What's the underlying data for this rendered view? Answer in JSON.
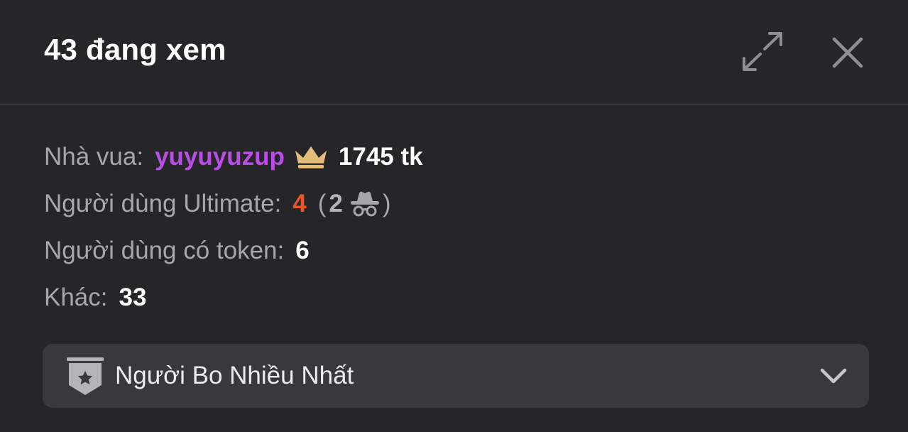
{
  "header": {
    "title": "43 đang xem",
    "expand_icon": "expand-arrows-icon",
    "close_icon": "close-icon"
  },
  "stats": {
    "king": {
      "label": "Nhà vua:",
      "name": "yuyuyuzup",
      "icon": "crown-icon",
      "amount": "1745 tk"
    },
    "ultimate": {
      "label": "Người dùng Ultimate:",
      "count": "4",
      "paren_open": "(",
      "anonymous_count": "2",
      "anonymous_icon": "incognito-icon",
      "paren_close": ")"
    },
    "token_users": {
      "label": "Người dùng có token:",
      "count": "6"
    },
    "other": {
      "label": "Khác:",
      "count": "33"
    }
  },
  "dropdown": {
    "label": "Người Bo Nhiều Nhất",
    "icon": "star-badge-icon",
    "chevron_icon": "chevron-down-icon"
  },
  "colors": {
    "background": "#262628",
    "king_name": "#b84ee6",
    "crown": "#e3bd7a",
    "ultimate_count": "#e8572c",
    "dropdown_bg": "#39393b"
  }
}
